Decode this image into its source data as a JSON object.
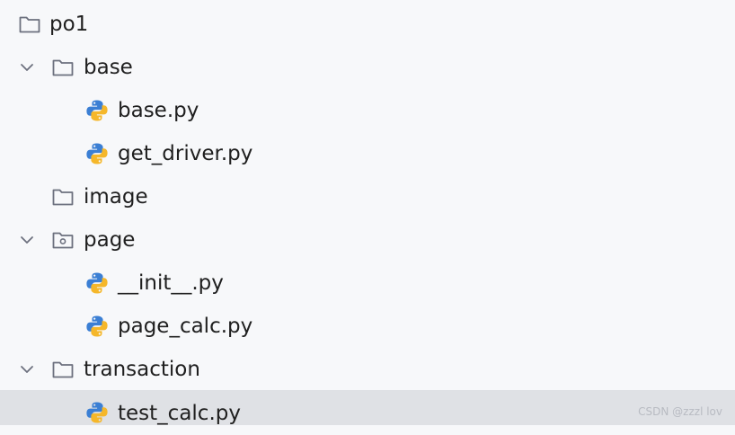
{
  "tree": {
    "items": [
      {
        "label": "po1",
        "type": "folder",
        "expanded": null
      },
      {
        "label": "base",
        "type": "folder",
        "expanded": true
      },
      {
        "label": "base.py",
        "type": "python-file"
      },
      {
        "label": "get_driver.py",
        "type": "python-file"
      },
      {
        "label": "image",
        "type": "folder",
        "expanded": null
      },
      {
        "label": "page",
        "type": "package-folder",
        "expanded": true
      },
      {
        "label": "__init__.py",
        "type": "python-file"
      },
      {
        "label": "page_calc.py",
        "type": "python-file"
      },
      {
        "label": "transaction",
        "type": "folder",
        "expanded": true
      },
      {
        "label": "test_calc.py",
        "type": "python-file",
        "selected": true
      }
    ]
  },
  "watermark": "CSDN @zzzl lov",
  "colors": {
    "background": "#f7f8fa",
    "selected_row": "#dfe1e5",
    "folder_stroke": "#6c707e",
    "python_blue": "#3b7fd4",
    "python_yellow": "#f5b72a"
  }
}
